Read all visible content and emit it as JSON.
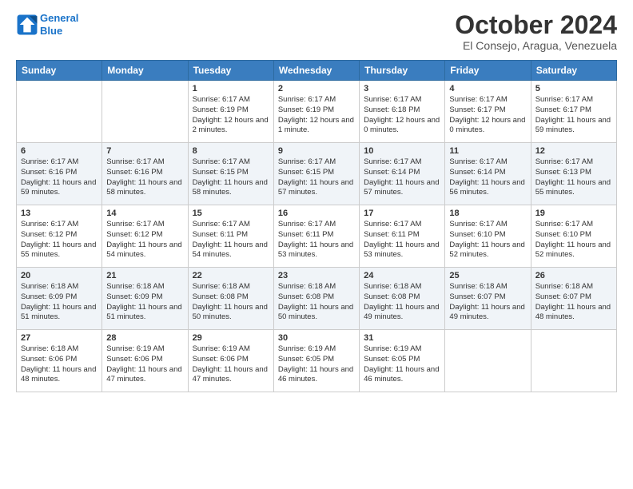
{
  "header": {
    "logo_line1": "General",
    "logo_line2": "Blue",
    "month": "October 2024",
    "location": "El Consejo, Aragua, Venezuela"
  },
  "days_of_week": [
    "Sunday",
    "Monday",
    "Tuesday",
    "Wednesday",
    "Thursday",
    "Friday",
    "Saturday"
  ],
  "weeks": [
    [
      {
        "day": "",
        "content": ""
      },
      {
        "day": "",
        "content": ""
      },
      {
        "day": "1",
        "sunrise": "Sunrise: 6:17 AM",
        "sunset": "Sunset: 6:19 PM",
        "daylight": "Daylight: 12 hours and 2 minutes."
      },
      {
        "day": "2",
        "sunrise": "Sunrise: 6:17 AM",
        "sunset": "Sunset: 6:19 PM",
        "daylight": "Daylight: 12 hours and 1 minute."
      },
      {
        "day": "3",
        "sunrise": "Sunrise: 6:17 AM",
        "sunset": "Sunset: 6:18 PM",
        "daylight": "Daylight: 12 hours and 0 minutes."
      },
      {
        "day": "4",
        "sunrise": "Sunrise: 6:17 AM",
        "sunset": "Sunset: 6:17 PM",
        "daylight": "Daylight: 12 hours and 0 minutes."
      },
      {
        "day": "5",
        "sunrise": "Sunrise: 6:17 AM",
        "sunset": "Sunset: 6:17 PM",
        "daylight": "Daylight: 11 hours and 59 minutes."
      }
    ],
    [
      {
        "day": "6",
        "sunrise": "Sunrise: 6:17 AM",
        "sunset": "Sunset: 6:16 PM",
        "daylight": "Daylight: 11 hours and 59 minutes."
      },
      {
        "day": "7",
        "sunrise": "Sunrise: 6:17 AM",
        "sunset": "Sunset: 6:16 PM",
        "daylight": "Daylight: 11 hours and 58 minutes."
      },
      {
        "day": "8",
        "sunrise": "Sunrise: 6:17 AM",
        "sunset": "Sunset: 6:15 PM",
        "daylight": "Daylight: 11 hours and 58 minutes."
      },
      {
        "day": "9",
        "sunrise": "Sunrise: 6:17 AM",
        "sunset": "Sunset: 6:15 PM",
        "daylight": "Daylight: 11 hours and 57 minutes."
      },
      {
        "day": "10",
        "sunrise": "Sunrise: 6:17 AM",
        "sunset": "Sunset: 6:14 PM",
        "daylight": "Daylight: 11 hours and 57 minutes."
      },
      {
        "day": "11",
        "sunrise": "Sunrise: 6:17 AM",
        "sunset": "Sunset: 6:14 PM",
        "daylight": "Daylight: 11 hours and 56 minutes."
      },
      {
        "day": "12",
        "sunrise": "Sunrise: 6:17 AM",
        "sunset": "Sunset: 6:13 PM",
        "daylight": "Daylight: 11 hours and 55 minutes."
      }
    ],
    [
      {
        "day": "13",
        "sunrise": "Sunrise: 6:17 AM",
        "sunset": "Sunset: 6:12 PM",
        "daylight": "Daylight: 11 hours and 55 minutes."
      },
      {
        "day": "14",
        "sunrise": "Sunrise: 6:17 AM",
        "sunset": "Sunset: 6:12 PM",
        "daylight": "Daylight: 11 hours and 54 minutes."
      },
      {
        "day": "15",
        "sunrise": "Sunrise: 6:17 AM",
        "sunset": "Sunset: 6:11 PM",
        "daylight": "Daylight: 11 hours and 54 minutes."
      },
      {
        "day": "16",
        "sunrise": "Sunrise: 6:17 AM",
        "sunset": "Sunset: 6:11 PM",
        "daylight": "Daylight: 11 hours and 53 minutes."
      },
      {
        "day": "17",
        "sunrise": "Sunrise: 6:17 AM",
        "sunset": "Sunset: 6:11 PM",
        "daylight": "Daylight: 11 hours and 53 minutes."
      },
      {
        "day": "18",
        "sunrise": "Sunrise: 6:17 AM",
        "sunset": "Sunset: 6:10 PM",
        "daylight": "Daylight: 11 hours and 52 minutes."
      },
      {
        "day": "19",
        "sunrise": "Sunrise: 6:17 AM",
        "sunset": "Sunset: 6:10 PM",
        "daylight": "Daylight: 11 hours and 52 minutes."
      }
    ],
    [
      {
        "day": "20",
        "sunrise": "Sunrise: 6:18 AM",
        "sunset": "Sunset: 6:09 PM",
        "daylight": "Daylight: 11 hours and 51 minutes."
      },
      {
        "day": "21",
        "sunrise": "Sunrise: 6:18 AM",
        "sunset": "Sunset: 6:09 PM",
        "daylight": "Daylight: 11 hours and 51 minutes."
      },
      {
        "day": "22",
        "sunrise": "Sunrise: 6:18 AM",
        "sunset": "Sunset: 6:08 PM",
        "daylight": "Daylight: 11 hours and 50 minutes."
      },
      {
        "day": "23",
        "sunrise": "Sunrise: 6:18 AM",
        "sunset": "Sunset: 6:08 PM",
        "daylight": "Daylight: 11 hours and 50 minutes."
      },
      {
        "day": "24",
        "sunrise": "Sunrise: 6:18 AM",
        "sunset": "Sunset: 6:08 PM",
        "daylight": "Daylight: 11 hours and 49 minutes."
      },
      {
        "day": "25",
        "sunrise": "Sunrise: 6:18 AM",
        "sunset": "Sunset: 6:07 PM",
        "daylight": "Daylight: 11 hours and 49 minutes."
      },
      {
        "day": "26",
        "sunrise": "Sunrise: 6:18 AM",
        "sunset": "Sunset: 6:07 PM",
        "daylight": "Daylight: 11 hours and 48 minutes."
      }
    ],
    [
      {
        "day": "27",
        "sunrise": "Sunrise: 6:18 AM",
        "sunset": "Sunset: 6:06 PM",
        "daylight": "Daylight: 11 hours and 48 minutes."
      },
      {
        "day": "28",
        "sunrise": "Sunrise: 6:19 AM",
        "sunset": "Sunset: 6:06 PM",
        "daylight": "Daylight: 11 hours and 47 minutes."
      },
      {
        "day": "29",
        "sunrise": "Sunrise: 6:19 AM",
        "sunset": "Sunset: 6:06 PM",
        "daylight": "Daylight: 11 hours and 47 minutes."
      },
      {
        "day": "30",
        "sunrise": "Sunrise: 6:19 AM",
        "sunset": "Sunset: 6:05 PM",
        "daylight": "Daylight: 11 hours and 46 minutes."
      },
      {
        "day": "31",
        "sunrise": "Sunrise: 6:19 AM",
        "sunset": "Sunset: 6:05 PM",
        "daylight": "Daylight: 11 hours and 46 minutes."
      },
      {
        "day": "",
        "content": ""
      },
      {
        "day": "",
        "content": ""
      }
    ]
  ]
}
